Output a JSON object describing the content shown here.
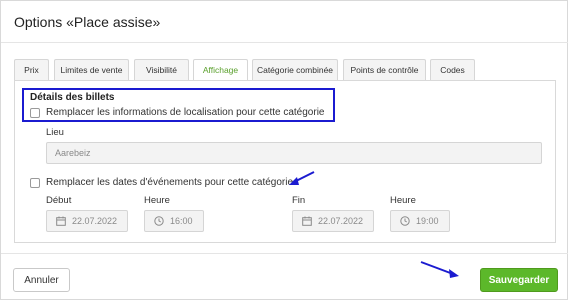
{
  "dialog": {
    "title": "Options «Place assise»"
  },
  "tabs": [
    {
      "label": "Prix"
    },
    {
      "label": "Limites de vente"
    },
    {
      "label": "Visibilité"
    },
    {
      "label": "Affichage"
    },
    {
      "label": "Catégorie combinée"
    },
    {
      "label": "Points de contrôle"
    },
    {
      "label": "Codes"
    }
  ],
  "active_tab": "Affichage",
  "ticket_details": {
    "title": "Détails des billets",
    "replace_location_label": "Remplacer les informations de localisation pour cette catégorie",
    "replace_location_checked": false,
    "location_label": "Lieu",
    "location_value": "Aarebeiz"
  },
  "event_dates": {
    "replace_dates_label": "Remplacer les dates d'événements pour cette catégorie",
    "replace_dates_checked": false,
    "start_label": "Début",
    "start_date": "22.07.2022",
    "start_time_label": "Heure",
    "start_time": "16:00",
    "end_label": "Fin",
    "end_date": "22.07.2022",
    "end_time_label": "Heure",
    "end_time": "19:00"
  },
  "footer": {
    "cancel_label": "Annuler",
    "save_label": "Sauvegarder"
  },
  "colors": {
    "accent_green": "#5cb82a",
    "annotation_blue": "#1b1bd0"
  },
  "icons": {
    "date": "calendar-icon",
    "time": "clock-icon"
  }
}
